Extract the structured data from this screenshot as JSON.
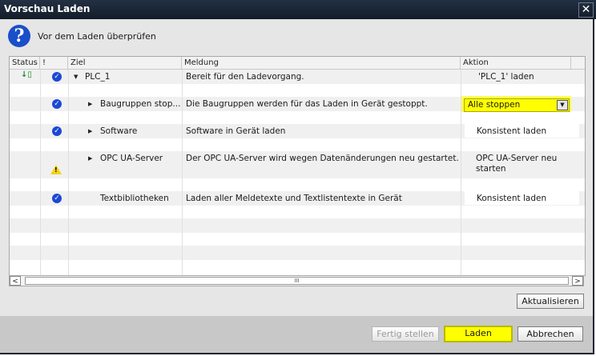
{
  "window": {
    "title": "Vorschau Laden",
    "close_glyph": "✕"
  },
  "header": {
    "text": "Vor dem Laden überprüfen"
  },
  "columns": [
    "Status",
    "!",
    "Ziel",
    "Meldung",
    "Aktion"
  ],
  "rows": [
    {
      "target": "PLC_1",
      "message": "Bereit für den Ladevorgang.",
      "action": "'PLC_1' laden"
    },
    {
      "target": "Baugruppen stop...",
      "message": "Die Baugruppen werden für das Laden in Gerät gestoppt.",
      "action": "Alle stoppen"
    },
    {
      "target": "Software",
      "message": "Software in Gerät laden",
      "action": "Konsistent laden"
    },
    {
      "target": "OPC UA-Server",
      "message": "Der OPC UA-Server wird wegen Datenänderungen neu gestartet.",
      "action_line1": "OPC UA-Server neu",
      "action_line2": "starten"
    },
    {
      "target": "Textbibliotheken",
      "message": "Laden aller Meldetexte und Textlistentexte in Gerät",
      "action": "Konsistent laden"
    }
  ],
  "scrollbar": {
    "left": "<",
    "right": ">",
    "thumb": "III"
  },
  "buttons": {
    "refresh": "Aktualisieren",
    "finish": "Fertig stellen",
    "load": "Laden",
    "cancel": "Abbrechen"
  },
  "colors": {
    "highlight": "#ffff00",
    "ok_icon": "#1a48d6",
    "warning": "#f2d31c",
    "title_bar": "#1c2533"
  }
}
